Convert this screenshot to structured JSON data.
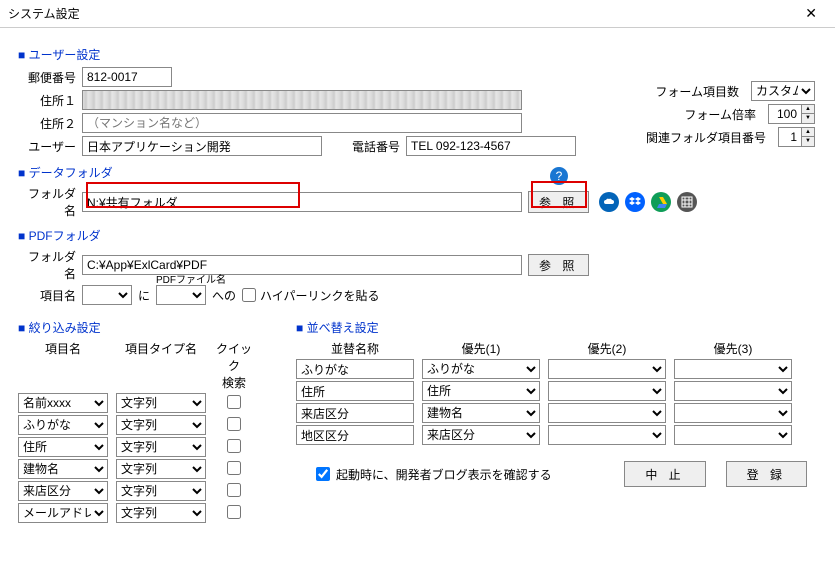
{
  "window": {
    "title": "システム設定"
  },
  "user_section": {
    "header": "ユーザー設定",
    "postal_label": "郵便番号",
    "postal_value": "812-0017",
    "addr1_label": "住所１",
    "addr1_value": "",
    "addr2_label": "住所２",
    "addr2_placeholder": "（マンション名など）",
    "user_label": "ユーザー",
    "user_value": "日本アプリケーション開発",
    "tel_label": "電話番号",
    "tel_value": "TEL 092-123-4567"
  },
  "top_right": {
    "form_items_label": "フォーム項目数",
    "form_items_value": "カスタム",
    "form_scale_label": "フォーム倍率",
    "form_scale_value": "100",
    "related_folder_label": "関連フォルダ項目番号",
    "related_folder_value": "1"
  },
  "data_folder": {
    "header": "データフォルダ",
    "name_label": "フォルダ名",
    "name_value": "N:¥共有フォルダ",
    "browse": "参 照"
  },
  "pdf_folder": {
    "header": "PDFフォルダ",
    "name_label": "フォルダ名",
    "name_value": "C:¥App¥ExlCard¥PDF",
    "browse": "参 照",
    "item_label": "項目名",
    "ni": "に",
    "pdf_file_label": "PDFファイル名",
    "heno": "への",
    "hyperlink_label": "ハイパーリンクを貼る"
  },
  "filter": {
    "header": "絞り込み設定",
    "col_item": "項目名",
    "col_type": "項目タイプ名",
    "col_quick1": "クイック",
    "col_quick2": "検索",
    "rows": [
      {
        "item": "名前xxxx",
        "type": "文字列"
      },
      {
        "item": "ふりがな",
        "type": "文字列"
      },
      {
        "item": "住所",
        "type": "文字列"
      },
      {
        "item": "建物名",
        "type": "文字列"
      },
      {
        "item": "来店区分",
        "type": "文字列"
      },
      {
        "item": "メールアドレ",
        "type": "文字列"
      }
    ]
  },
  "sort": {
    "header": "並べ替え設定",
    "col_name": "並替名称",
    "col_p1": "優先(1)",
    "col_p2": "優先(2)",
    "col_p3": "優先(3)",
    "rows": [
      {
        "name": "ふりがな",
        "p1": "ふりがな"
      },
      {
        "name": "住所",
        "p1": "住所"
      },
      {
        "name": "来店区分",
        "p1": "建物名"
      },
      {
        "name": "地区区分",
        "p1": "来店区分"
      }
    ]
  },
  "bottom": {
    "startup_label": "起動時に、開発者ブログ表示を確認する",
    "cancel": "中 止",
    "register": "登 録"
  }
}
